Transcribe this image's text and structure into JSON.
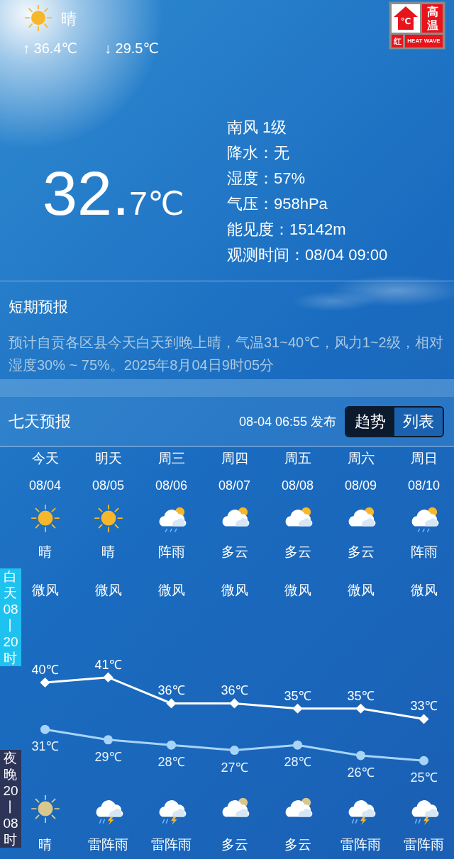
{
  "header": {
    "condition": "晴",
    "high": "↑ 36.4℃",
    "low": "↓ 29.5℃",
    "kind": "sunny"
  },
  "badge": {
    "icon_text": "℃",
    "title": "高温",
    "grade": "红",
    "english": "HEAT WAVE"
  },
  "current": {
    "temp_main": "32.",
    "temp_decimal": "7℃",
    "details": [
      "南风 1级",
      "降水：无",
      "湿度：57%",
      "气压：958hPa",
      "能见度：15142m",
      "观测时间：08/04 09:00"
    ]
  },
  "short_forecast": {
    "title": "短期预报",
    "text": "预计自贡各区县今天白天到晚上晴，气温31~40℃，风力1~2级，相对湿度30% ~ 75%。2025年8月04日9时05分"
  },
  "seven_day": {
    "title": "七天预报",
    "published": "08-04 06:55 发布",
    "view_tabs": [
      {
        "label": "趋势",
        "selected": true
      },
      {
        "label": "列表",
        "selected": false
      }
    ],
    "day_label": "白天08丨20时",
    "night_label": "夜晚20丨08时",
    "days": [
      {
        "weekday": "今天",
        "date": "08/04",
        "day": {
          "kind": "sunny",
          "text": "晴"
        },
        "wind": "微风",
        "night": {
          "kind": "sunny",
          "text": "晴"
        }
      },
      {
        "weekday": "明天",
        "date": "08/05",
        "day": {
          "kind": "sunny",
          "text": "晴"
        },
        "wind": "微风",
        "night": {
          "kind": "thunder",
          "text": "雷阵雨"
        }
      },
      {
        "weekday": "周三",
        "date": "08/06",
        "day": {
          "kind": "shower",
          "text": "阵雨"
        },
        "wind": "微风",
        "night": {
          "kind": "thunder",
          "text": "雷阵雨"
        }
      },
      {
        "weekday": "周四",
        "date": "08/07",
        "day": {
          "kind": "cloudy",
          "text": "多云"
        },
        "wind": "微风",
        "night": {
          "kind": "cloudy",
          "text": "多云"
        }
      },
      {
        "weekday": "周五",
        "date": "08/08",
        "day": {
          "kind": "cloudy",
          "text": "多云"
        },
        "wind": "微风",
        "night": {
          "kind": "cloudy",
          "text": "多云"
        }
      },
      {
        "weekday": "周六",
        "date": "08/09",
        "day": {
          "kind": "cloudy",
          "text": "多云"
        },
        "wind": "微风",
        "night": {
          "kind": "thunder",
          "text": "雷阵雨"
        }
      },
      {
        "weekday": "周日",
        "date": "08/10",
        "day": {
          "kind": "shower",
          "text": "阵雨"
        },
        "wind": "微风",
        "night": {
          "kind": "thunder",
          "text": "雷阵雨"
        }
      }
    ],
    "chart_data": {
      "type": "line",
      "data_labels": true,
      "series": [
        {
          "color": "#ffffff",
          "marker": "diamond",
          "values": [
            40,
            41,
            36,
            36,
            35,
            35,
            33
          ],
          "value_labels": [
            "40℃",
            "41℃",
            "36℃",
            "36℃",
            "35℃",
            "35℃",
            "33℃"
          ]
        },
        {
          "color": "#a8d4f8",
          "marker": "circle",
          "values": [
            31,
            29,
            28,
            27,
            28,
            26,
            25
          ],
          "value_labels": [
            "31℃",
            "29℃",
            "28℃",
            "27℃",
            "28℃",
            "26℃",
            "25℃"
          ]
        }
      ]
    }
  }
}
